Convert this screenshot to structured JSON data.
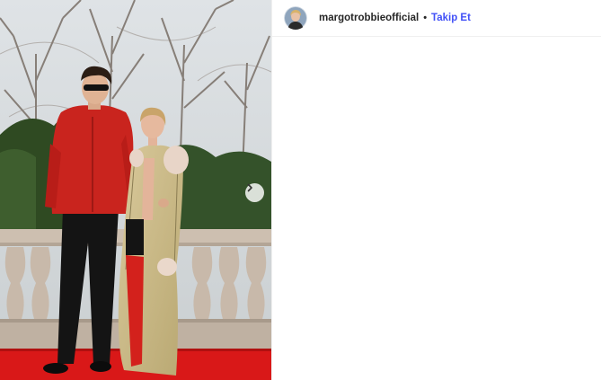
{
  "post": {
    "username": "margotrobbieofficial",
    "separator": "•",
    "follow_label": "Takip Et",
    "icons": {
      "avatar": "profile-avatar",
      "next": "chevron-right-icon"
    },
    "colors": {
      "follow": "#4150f7",
      "carpet": "#d91818"
    }
  }
}
